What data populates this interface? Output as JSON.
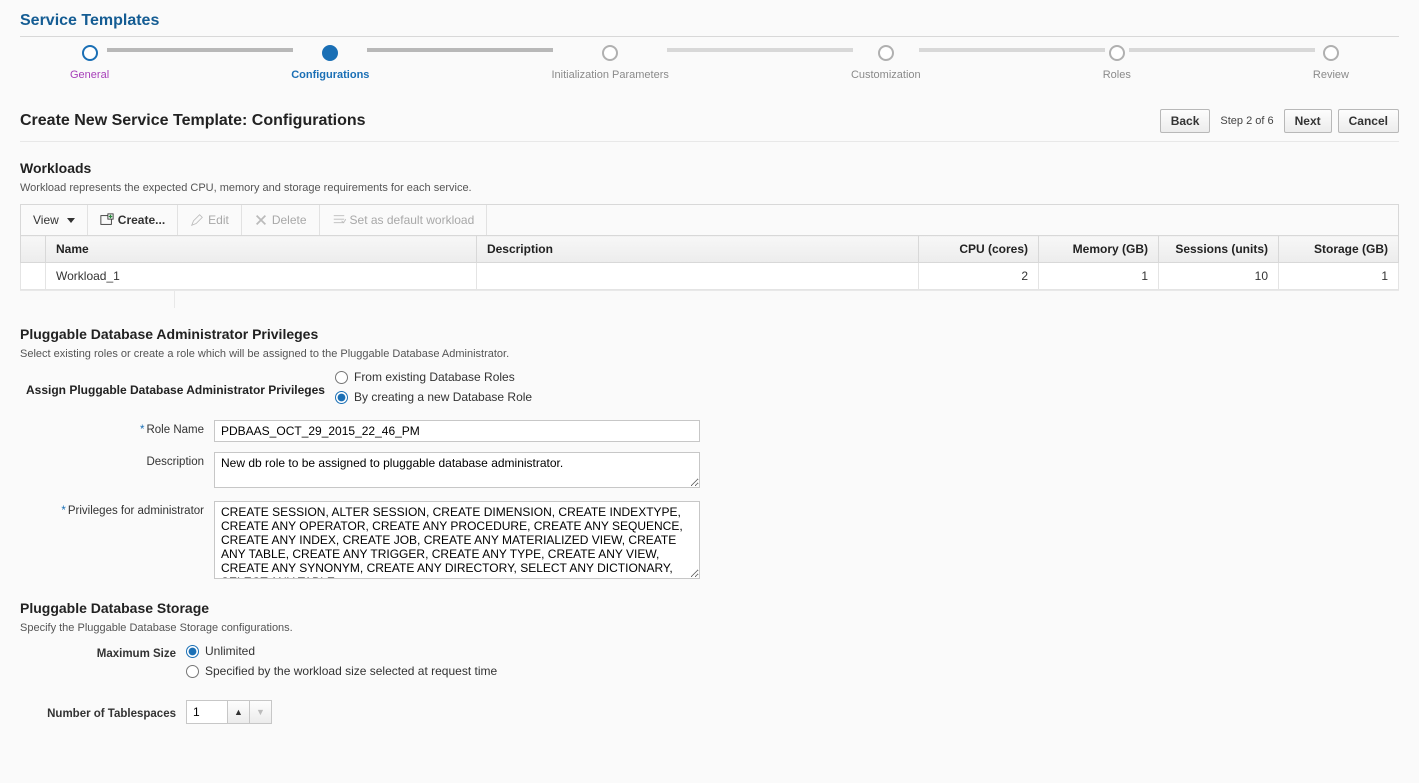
{
  "pageTitle": "Service Templates",
  "wizard": {
    "steps": [
      {
        "label": "General",
        "state": "done"
      },
      {
        "label": "Configurations",
        "state": "current"
      },
      {
        "label": "Initialization Parameters",
        "state": "future"
      },
      {
        "label": "Customization",
        "state": "future"
      },
      {
        "label": "Roles",
        "state": "future"
      },
      {
        "label": "Review",
        "state": "future"
      }
    ]
  },
  "header": {
    "title": "Create New Service Template: Configurations",
    "back": "Back",
    "stepIndicator": "Step 2 of 6",
    "next": "Next",
    "cancel": "Cancel"
  },
  "workloads": {
    "title": "Workloads",
    "desc": "Workload represents the expected CPU, memory and storage requirements for each service.",
    "toolbar": {
      "view": "View",
      "create": "Create...",
      "edit": "Edit",
      "delete": "Delete",
      "setDefault": "Set as default workload"
    },
    "columns": {
      "name": "Name",
      "description": "Description",
      "cpu": "CPU (cores)",
      "memory": "Memory (GB)",
      "sessions": "Sessions (units)",
      "storage": "Storage (GB)"
    },
    "rows": [
      {
        "name": "Workload_1",
        "description": "",
        "cpu": "2",
        "memory": "1",
        "sessions": "10",
        "storage": "1"
      }
    ]
  },
  "pdbAdmin": {
    "title": "Pluggable Database Administrator Privileges",
    "desc": "Select existing roles or create a role which will be assigned to the Pluggable Database Administrator.",
    "assignLabel": "Assign Pluggable Database Administrator Privileges",
    "optExisting": "From existing Database Roles",
    "optNew": "By creating a new Database Role",
    "selected": "new",
    "roleNameLabel": "Role Name",
    "roleName": "PDBAAS_OCT_29_2015_22_46_PM",
    "descriptionLabel": "Description",
    "description": "New db role to be assigned to pluggable database administrator.",
    "privilegesLabel": "Privileges for administrator",
    "privileges": "CREATE SESSION, ALTER SESSION, CREATE DIMENSION, CREATE INDEXTYPE, CREATE ANY OPERATOR, CREATE ANY PROCEDURE, CREATE ANY SEQUENCE, CREATE ANY INDEX, CREATE JOB, CREATE ANY MATERIALIZED VIEW, CREATE ANY TABLE, CREATE ANY TRIGGER, CREATE ANY TYPE, CREATE ANY VIEW, CREATE ANY SYNONYM, CREATE ANY DIRECTORY, SELECT ANY DICTIONARY, SELECT ANY TABLE"
  },
  "pdbStorage": {
    "title": "Pluggable Database Storage",
    "desc": "Specify the Pluggable Database Storage configurations.",
    "maxSizeLabel": "Maximum Size",
    "optUnlimited": "Unlimited",
    "optWorkload": "Specified by the workload size selected at request time",
    "selected": "unlimited",
    "numTablespacesLabel": "Number of Tablespaces",
    "numTablespaces": "1"
  }
}
